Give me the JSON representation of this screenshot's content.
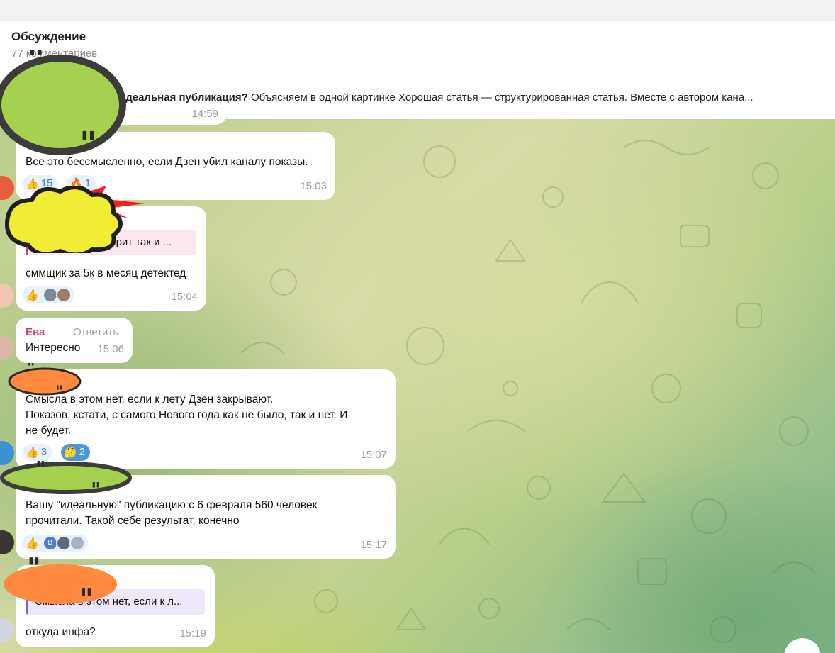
{
  "header": {
    "title": "Обсуждение",
    "subtitle": "77 комментариев"
  },
  "pinned": {
    "title": "идеальная публикация?",
    "text": "Объясняем в одной картинке  Хорошая статья — структурированная статья. Вместе с автором кана...",
    "time": "14:59"
  },
  "messages": [
    {
      "text": "Все это бессмысленно, если Дзен убил каналу показы.",
      "time": "15:03",
      "reactions": [
        {
          "emoji": "👍",
          "count": "15",
          "active": false
        },
        {
          "emoji": "🔥",
          "count": "1",
          "active": false
        }
      ]
    },
    {
      "reply": "Как в голову вдарит так и ...",
      "text": "сммщик за 5к в месяц детектед",
      "time": "15:04",
      "reactions": [
        {
          "emoji": "👍",
          "count": "",
          "active": false
        }
      ]
    },
    {
      "author": "Ева",
      "author_color": "#c24a74",
      "reply_label": "Ответить",
      "text": "Интересно",
      "time": "15:06"
    },
    {
      "text_lines": [
        "Смысла в этом нет, если к лету Дзен закрывают.",
        "Показов, кстати, с самого Нового года как не было, так и нет. И",
        "не будет."
      ],
      "time": "15:07",
      "reactions": [
        {
          "emoji": "👍",
          "count": "3",
          "active": false
        },
        {
          "emoji": "🤔",
          "count": "2",
          "active": true
        }
      ]
    },
    {
      "text_lines": [
        "Вашу \"идеальную\" публикацию с 6 февраля 560 человек",
        "прочитали. Такой себе результат, конечно"
      ],
      "time": "15:17",
      "reactions": [
        {
          "emoji": "👍",
          "count": "",
          "active": false
        }
      ],
      "mini_avatar_letter": "В"
    },
    {
      "reply": "Смысла в этом нет, если к л...",
      "text": "откуда инфа?",
      "time": "15:19"
    }
  ],
  "colors": {
    "accent": "#4a95de",
    "reaction_bg": "#e7f0fb",
    "author_pink": "#c24a74",
    "quote_purple": "#8d60cf"
  }
}
